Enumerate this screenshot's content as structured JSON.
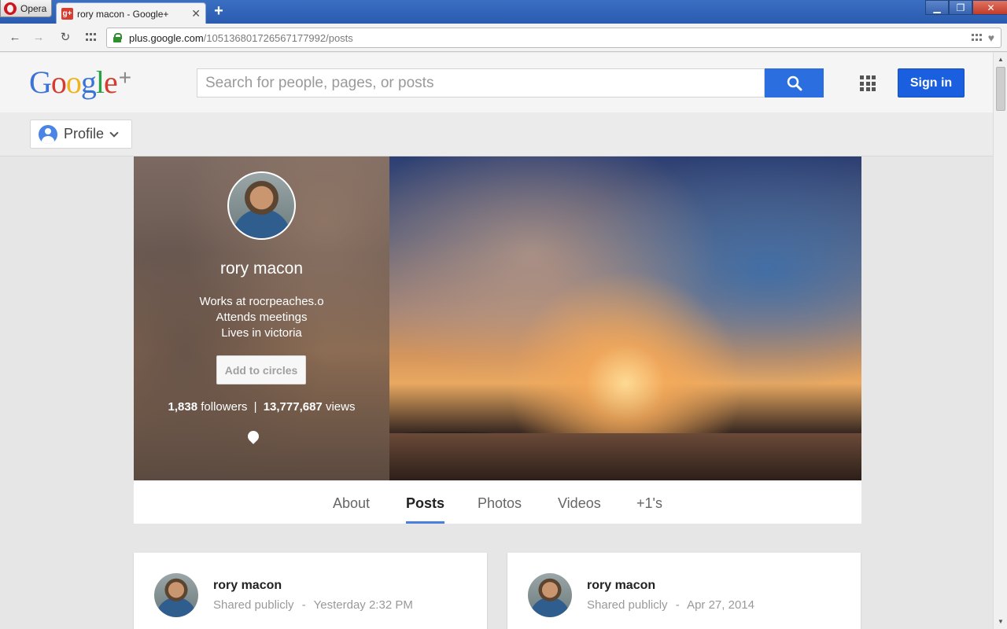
{
  "browser": {
    "opera_label": "Opera",
    "tab_title": "rory macon - Google+",
    "tab_favicon": "g+",
    "url_host": "plus.google.com",
    "url_path": "/105136801726567177992/posts"
  },
  "header": {
    "logo_letters": [
      "G",
      "o",
      "o",
      "g",
      "l",
      "e"
    ],
    "logo_plus": "+",
    "search_placeholder": "Search for people, pages, or posts",
    "signin_label": "Sign in"
  },
  "subbar": {
    "profile_label": "Profile"
  },
  "profile": {
    "name": "rory macon",
    "work": "Works at rocrpeaches.o",
    "attends": "Attends meetings",
    "lives": "Lives in victoria",
    "circles_button": "Add to circles",
    "followers_count": "1,838",
    "followers_label": "followers",
    "separator": "|",
    "views_count": "13,777,687",
    "views_label": "views"
  },
  "tabs": [
    {
      "label": "About",
      "active": false
    },
    {
      "label": "Posts",
      "active": true
    },
    {
      "label": "Photos",
      "active": false
    },
    {
      "label": "Videos",
      "active": false
    },
    {
      "label": "+1's",
      "active": false
    }
  ],
  "posts": [
    {
      "author": "rory macon",
      "visibility": "Shared publicly",
      "sep": "-",
      "time": "Yesterday 2:32 PM"
    },
    {
      "author": "rory macon",
      "visibility": "Shared publicly",
      "sep": "-",
      "time": "Apr 27, 2014"
    }
  ],
  "colors": {
    "accent_blue": "#2a6ee0",
    "signin_blue": "#1a5fe0",
    "tab_underline": "#4a7fe0"
  },
  "icons": [
    "back-icon",
    "forward-icon",
    "reload-icon",
    "speed-dial-icon",
    "lock-icon",
    "search-icon",
    "apps-icon",
    "person-icon",
    "chevron-down-icon",
    "location-pin-icon",
    "heart-icon"
  ]
}
